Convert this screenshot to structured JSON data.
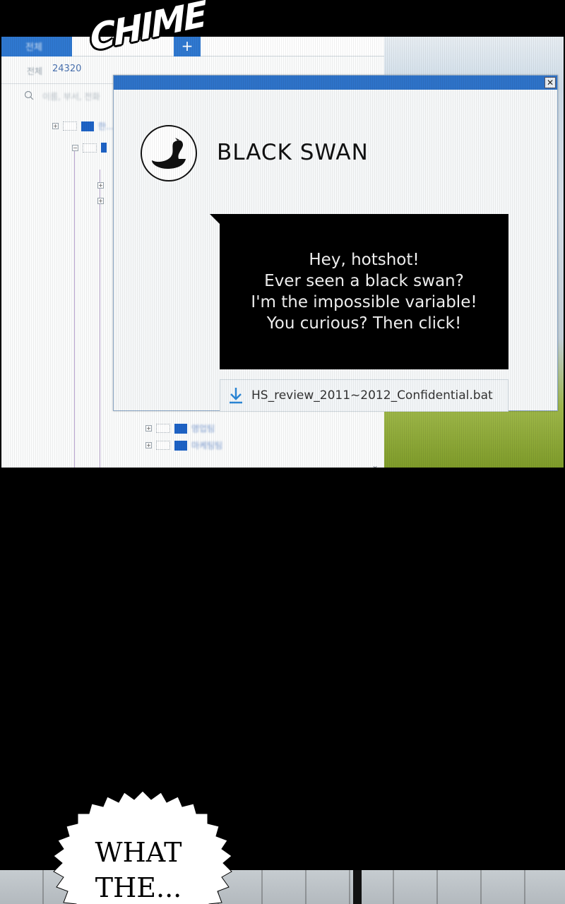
{
  "sfx": {
    "text": "CHIME"
  },
  "explorer": {
    "tab_label": "전체",
    "new_tab_icon": "plus-icon",
    "count_label": "전체",
    "count_value": "24320",
    "search_placeholder": "이름, 부서, 전화",
    "tree_items": [
      {
        "label": "한..."
      },
      {
        "label": ""
      },
      {
        "label": ""
      },
      {
        "label": ""
      },
      {
        "label": "영업팀"
      },
      {
        "label": "마케팅팀"
      }
    ]
  },
  "popup": {
    "brand_name": "BLACK SWAN",
    "logo_icon": "black-swan-logo-icon",
    "message_lines": [
      "Hey, hotshot!",
      "Ever seen a black swan?",
      "I'm the impossible variable!",
      "You curious?  Then click!"
    ],
    "attachment": {
      "icon": "download-icon",
      "filename": "HS_review_2011~2012_Confidential.bat"
    },
    "close_label": "✕"
  },
  "speech": {
    "lines": [
      "WHAT",
      "THE..."
    ]
  },
  "colors": {
    "accent_blue": "#2e73c9",
    "bubble_black": "#000000"
  }
}
